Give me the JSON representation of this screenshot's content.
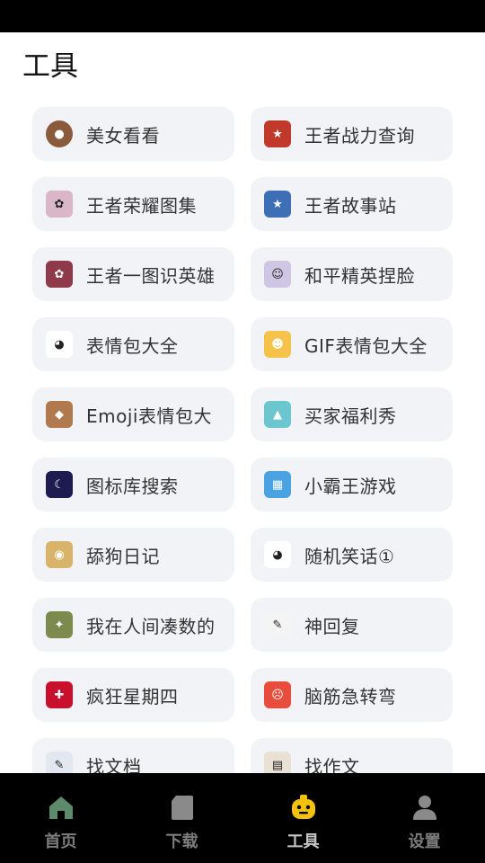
{
  "page": {
    "title": "工具"
  },
  "tools": [
    {
      "label": "美女看看",
      "icon": "portrait-icon",
      "color": "#8a5a3c"
    },
    {
      "label": "王者战力查询",
      "icon": "game-hero-icon",
      "color": "#c0392b"
    },
    {
      "label": "王者荣耀图集",
      "icon": "anime-girl-icon",
      "color": "#d9b7c9"
    },
    {
      "label": "王者故事站",
      "icon": "game-hero-icon",
      "color": "#3d6fb6"
    },
    {
      "label": "王者一图识英雄",
      "icon": "anime-girl-icon",
      "color": "#8e3a4a"
    },
    {
      "label": "和平精英捏脸",
      "icon": "face-icon",
      "color": "#cfc6e3"
    },
    {
      "label": "表情包大全",
      "icon": "panda-meme-icon",
      "color": "#ffffff"
    },
    {
      "label": "GIF表情包大全",
      "icon": "duck-emoji-icon",
      "color": "#f6c34a"
    },
    {
      "label": "Emoji表情包大",
      "icon": "cat-photo-icon",
      "color": "#b07a4e"
    },
    {
      "label": "买家福利秀",
      "icon": "landscape-icon",
      "color": "#6cc6cf"
    },
    {
      "label": "图标库搜索",
      "icon": "moon-icon",
      "color": "#1d1b4f"
    },
    {
      "label": "小霸王游戏",
      "icon": "retro-game-icon",
      "color": "#4aa3e0"
    },
    {
      "label": "舔狗日记",
      "icon": "doge-icon",
      "color": "#d7b46a"
    },
    {
      "label": "随机笑话①",
      "icon": "panda-meme-icon",
      "color": "#ffffff"
    },
    {
      "label": "我在人间凑数的",
      "icon": "illustration-icon",
      "color": "#7c8a4e"
    },
    {
      "label": "神回复",
      "icon": "sketch-icon",
      "color": "#f4f4f4"
    },
    {
      "label": "疯狂星期四",
      "icon": "kfc-icon",
      "color": "#c8102e"
    },
    {
      "label": "脑筋急转弯",
      "icon": "cartoon-face-icon",
      "color": "#e74c3c"
    },
    {
      "label": "找文档",
      "icon": "document-icon",
      "color": "#e3e8f0"
    },
    {
      "label": "找作文",
      "icon": "book-icon",
      "color": "#e8e1d4"
    }
  ],
  "nav": [
    {
      "label": "首页",
      "icon": "home-icon"
    },
    {
      "label": "下载",
      "icon": "download-icon"
    },
    {
      "label": "工具",
      "icon": "tools-icon",
      "active": true
    },
    {
      "label": "设置",
      "icon": "user-settings-icon"
    }
  ],
  "colors": {
    "card_bg": "#f2f3f7",
    "nav_bg": "#000000",
    "active": "#f4c20d",
    "inactive": "#7d7d7d"
  }
}
